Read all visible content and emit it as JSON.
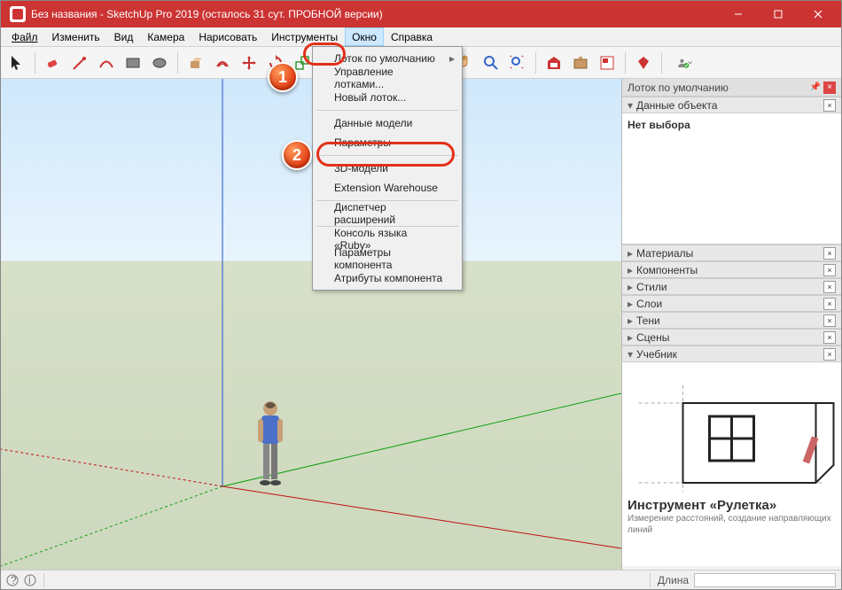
{
  "title": "Без названия - SketchUp Pro 2019 (осталось 31 сут. ПРОБНОЙ версии)",
  "callouts": {
    "one": "1",
    "two": "2"
  },
  "menubar": {
    "file": "Файл",
    "edit": "Изменить",
    "view": "Вид",
    "camera": "Камера",
    "draw": "Нарисовать",
    "tools": "Инструменты",
    "window": "Окно",
    "help": "Справка"
  },
  "dropdown": {
    "default_tray": "Лоток по умолчанию",
    "manage_trays": "Управление лотками...",
    "new_tray": "Новый лоток...",
    "model_info": "Данные модели",
    "preferences": "Параметры",
    "3d_warehouse": "3D-модели",
    "ext_warehouse": "Extension Warehouse",
    "ext_manager": "Диспетчер расширений",
    "ruby_console": "Консоль языка «Ruby»",
    "comp_options": "Параметры компонента",
    "comp_attrs": "Атрибуты компонента"
  },
  "tray": {
    "title": "Лоток по умолчанию",
    "entity_info": "Данные объекта",
    "no_selection": "Нет выбора",
    "materials": "Материалы",
    "components": "Компоненты",
    "styles": "Стили",
    "layers": "Слои",
    "shadows": "Тени",
    "scenes": "Сцены",
    "instructor": "Учебник",
    "instructor_title": "Инструмент «Рулетка»",
    "instructor_text": "Измерение расстояний, создание направляющих линий"
  },
  "status": {
    "length_label": "Длина"
  }
}
